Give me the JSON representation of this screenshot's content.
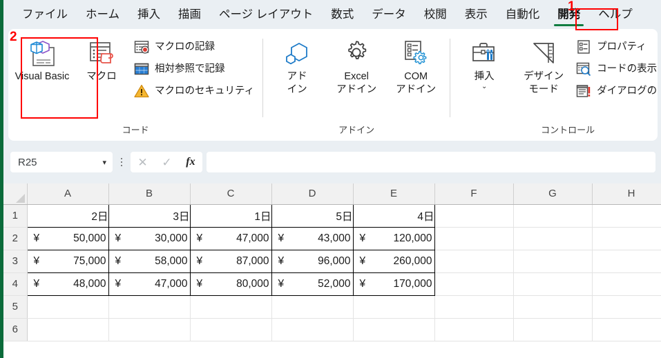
{
  "app": {
    "left_rail_color": "#0b6b3a",
    "accent_color": "#107c41",
    "annotation_color": "#ff0000"
  },
  "tabs": [
    {
      "label": "ファイル",
      "selected": false
    },
    {
      "label": "ホーム",
      "selected": false
    },
    {
      "label": "挿入",
      "selected": false
    },
    {
      "label": "描画",
      "selected": false
    },
    {
      "label": "ページ レイアウト",
      "selected": false
    },
    {
      "label": "数式",
      "selected": false
    },
    {
      "label": "データ",
      "selected": false
    },
    {
      "label": "校閲",
      "selected": false
    },
    {
      "label": "表示",
      "selected": false
    },
    {
      "label": "自動化",
      "selected": false
    },
    {
      "label": "開発",
      "selected": true
    },
    {
      "label": "ヘルプ",
      "selected": false
    }
  ],
  "annotations": [
    {
      "number": "1",
      "target": "tab-developer"
    },
    {
      "number": "2",
      "target": "visual-basic-button"
    }
  ],
  "ribbon": {
    "groups": [
      {
        "name": "code",
        "label": "コード",
        "big_buttons": [
          {
            "label": "Visual Basic",
            "icon": "visual-basic-icon",
            "highlighted": true
          },
          {
            "label": "マクロ",
            "icon": "macros-icon",
            "highlighted": false
          }
        ],
        "small_buttons": [
          {
            "label": "マクロの記録",
            "icon": "record-macro-icon"
          },
          {
            "label": "相対参照で記録",
            "icon": "relative-reference-icon"
          },
          {
            "label": "マクロのセキュリティ",
            "icon": "macro-security-icon"
          }
        ]
      },
      {
        "name": "addins",
        "label": "アドイン",
        "big_buttons": [
          {
            "label": "アド\nイン",
            "icon": "addins-icon",
            "highlighted": false
          },
          {
            "label": "Excel\nアドイン",
            "icon": "excel-addins-icon",
            "highlighted": false
          },
          {
            "label": "COM\nアドイン",
            "icon": "com-addins-icon",
            "highlighted": false
          }
        ],
        "small_buttons": []
      },
      {
        "name": "controls",
        "label": "コントロール",
        "big_buttons": [
          {
            "label": "挿入",
            "icon": "insert-control-icon",
            "highlighted": false,
            "has_caret": true
          },
          {
            "label": "デザイン\nモード",
            "icon": "design-mode-icon",
            "highlighted": false
          }
        ],
        "small_buttons": [
          {
            "label": "プロパティ",
            "icon": "properties-icon"
          },
          {
            "label": "コードの表示",
            "icon": "view-code-icon"
          },
          {
            "label": "ダイアログの実行",
            "icon": "run-dialog-icon"
          }
        ]
      }
    ]
  },
  "formula_bar": {
    "name_box_value": "R25",
    "cancel_icon": "cancel-icon",
    "enter_icon": "enter-icon",
    "function_icon": "insert-function-icon",
    "formula_value": "",
    "formula_placeholder": ""
  },
  "sheet": {
    "column_headers": [
      "A",
      "B",
      "C",
      "D",
      "E",
      "F",
      "G",
      "H"
    ],
    "row_headers": [
      "1",
      "2",
      "3",
      "4",
      "5",
      "6"
    ],
    "rows": [
      {
        "header": "1",
        "cells": [
          {
            "text": "2日",
            "type": "day",
            "bordered": true
          },
          {
            "text": "3日",
            "type": "day",
            "bordered": true
          },
          {
            "text": "1日",
            "type": "day",
            "bordered": true
          },
          {
            "text": "5日",
            "type": "day",
            "bordered": true
          },
          {
            "text": "4日",
            "type": "day",
            "bordered": true
          },
          {
            "text": "",
            "type": "empty",
            "bordered": false
          },
          {
            "text": "",
            "type": "empty",
            "bordered": false
          },
          {
            "text": "",
            "type": "empty",
            "bordered": false
          }
        ]
      },
      {
        "header": "2",
        "cells": [
          {
            "text": "50,000",
            "currency": "¥",
            "type": "money",
            "bordered": true
          },
          {
            "text": "30,000",
            "currency": "¥",
            "type": "money",
            "bordered": true
          },
          {
            "text": "47,000",
            "currency": "¥",
            "type": "money",
            "bordered": true
          },
          {
            "text": "43,000",
            "currency": "¥",
            "type": "money",
            "bordered": true
          },
          {
            "text": "120,000",
            "currency": "¥",
            "type": "money",
            "bordered": true
          },
          {
            "text": "",
            "type": "empty",
            "bordered": false
          },
          {
            "text": "",
            "type": "empty",
            "bordered": false
          },
          {
            "text": "",
            "type": "empty",
            "bordered": false
          }
        ]
      },
      {
        "header": "3",
        "cells": [
          {
            "text": "75,000",
            "currency": "¥",
            "type": "money",
            "bordered": true
          },
          {
            "text": "58,000",
            "currency": "¥",
            "type": "money",
            "bordered": true
          },
          {
            "text": "87,000",
            "currency": "¥",
            "type": "money",
            "bordered": true
          },
          {
            "text": "96,000",
            "currency": "¥",
            "type": "money",
            "bordered": true
          },
          {
            "text": "260,000",
            "currency": "¥",
            "type": "money",
            "bordered": true
          },
          {
            "text": "",
            "type": "empty",
            "bordered": false
          },
          {
            "text": "",
            "type": "empty",
            "bordered": false
          },
          {
            "text": "",
            "type": "empty",
            "bordered": false
          }
        ]
      },
      {
        "header": "4",
        "cells": [
          {
            "text": "48,000",
            "currency": "¥",
            "type": "money",
            "bordered": true
          },
          {
            "text": "47,000",
            "currency": "¥",
            "type": "money",
            "bordered": true
          },
          {
            "text": "80,000",
            "currency": "¥",
            "type": "money",
            "bordered": true
          },
          {
            "text": "52,000",
            "currency": "¥",
            "type": "money",
            "bordered": true
          },
          {
            "text": "170,000",
            "currency": "¥",
            "type": "money",
            "bordered": true
          },
          {
            "text": "",
            "type": "empty",
            "bordered": false
          },
          {
            "text": "",
            "type": "empty",
            "bordered": false
          },
          {
            "text": "",
            "type": "empty",
            "bordered": false
          }
        ]
      },
      {
        "header": "5",
        "cells": [
          {
            "text": "",
            "type": "empty",
            "bordered": false
          },
          {
            "text": "",
            "type": "empty",
            "bordered": false
          },
          {
            "text": "",
            "type": "empty",
            "bordered": false
          },
          {
            "text": "",
            "type": "empty",
            "bordered": false
          },
          {
            "text": "",
            "type": "empty",
            "bordered": false
          },
          {
            "text": "",
            "type": "empty",
            "bordered": false
          },
          {
            "text": "",
            "type": "empty",
            "bordered": false
          },
          {
            "text": "",
            "type": "empty",
            "bordered": false
          }
        ]
      },
      {
        "header": "6",
        "cells": [
          {
            "text": "",
            "type": "empty",
            "bordered": false
          },
          {
            "text": "",
            "type": "empty",
            "bordered": false
          },
          {
            "text": "",
            "type": "empty",
            "bordered": false
          },
          {
            "text": "",
            "type": "empty",
            "bordered": false
          },
          {
            "text": "",
            "type": "empty",
            "bordered": false
          },
          {
            "text": "",
            "type": "empty",
            "bordered": false
          },
          {
            "text": "",
            "type": "empty",
            "bordered": false
          },
          {
            "text": "",
            "type": "empty",
            "bordered": false
          }
        ]
      }
    ]
  }
}
